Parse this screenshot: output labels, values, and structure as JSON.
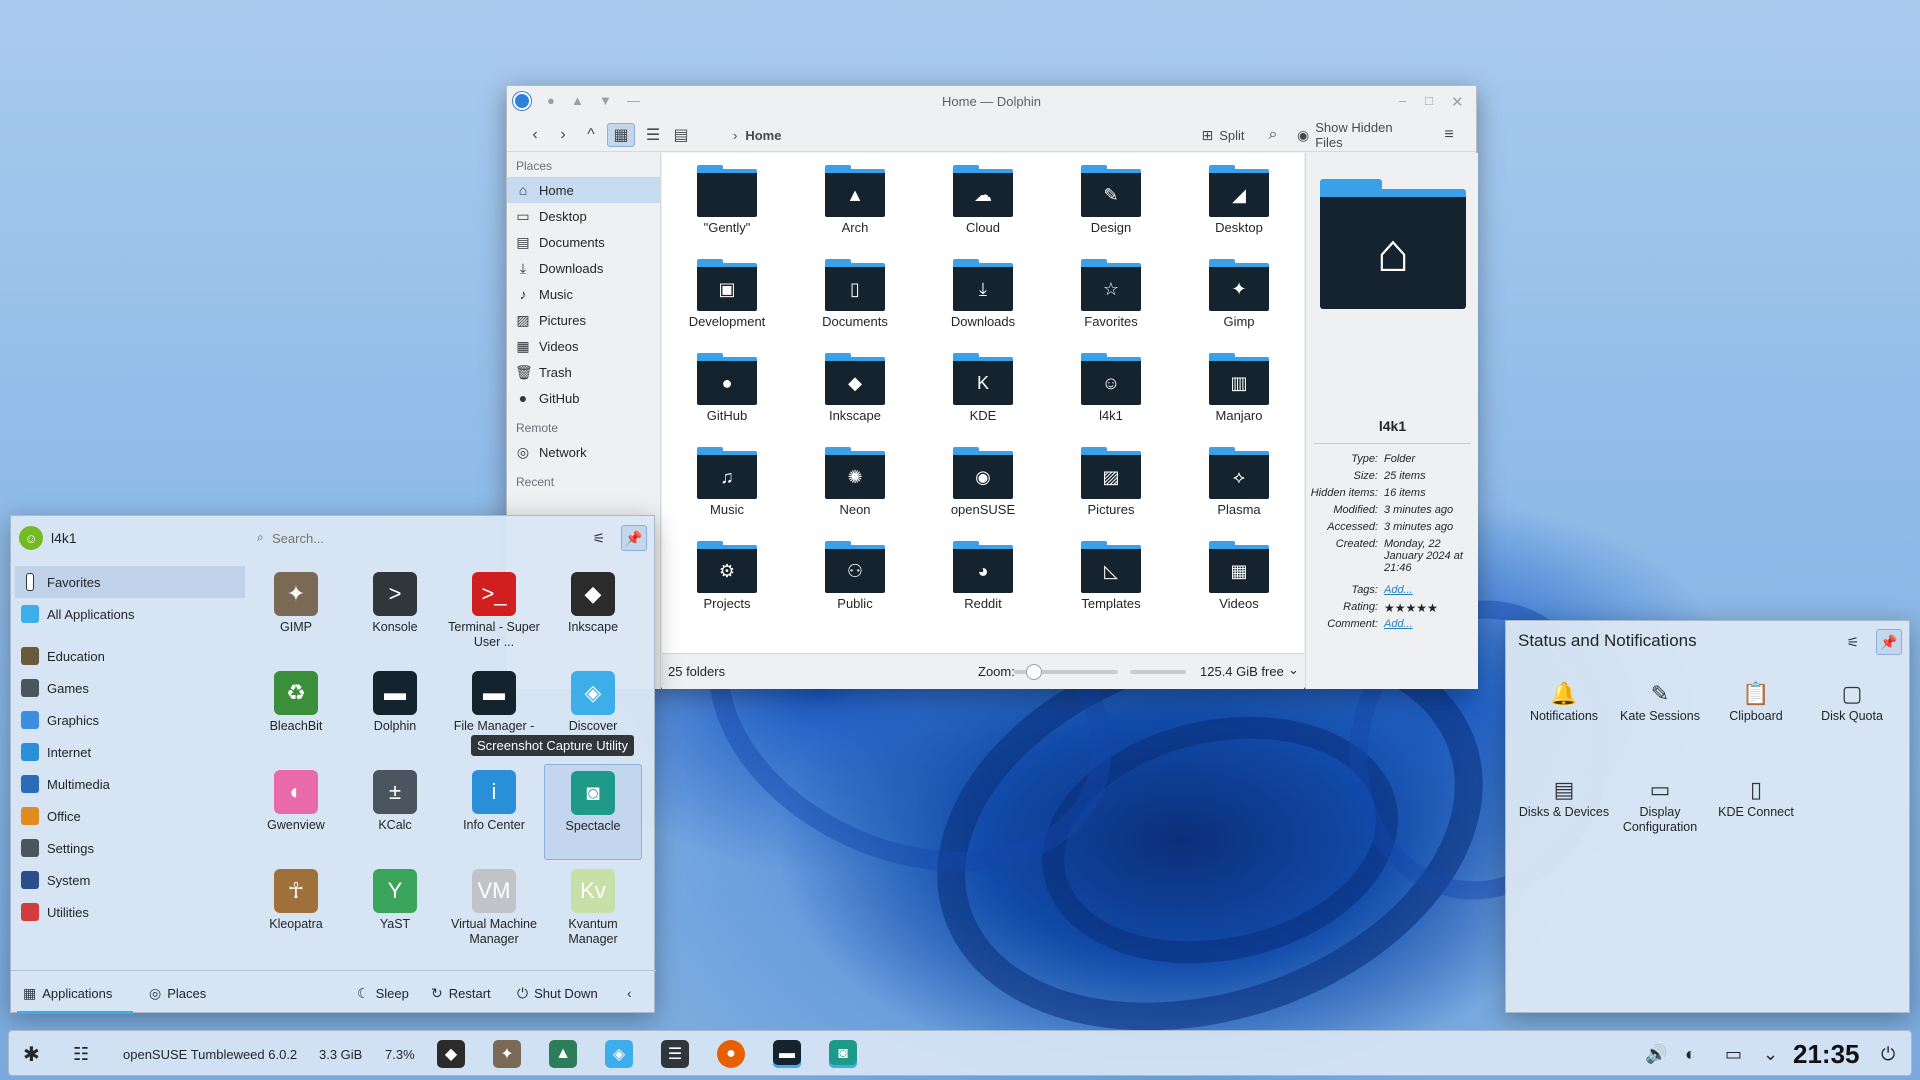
{
  "dolphin": {
    "title": "Home — Dolphin",
    "breadcrumb": "Home",
    "split_label": "Split",
    "hidden_files_label": "Show Hidden Files",
    "places": {
      "section_places": "Places",
      "section_remote": "Remote",
      "section_recent": "Recent",
      "items": [
        {
          "label": "Home",
          "icon": "home-icon",
          "glyph": "⌂"
        },
        {
          "label": "Desktop",
          "icon": "desktop-icon",
          "glyph": "▭"
        },
        {
          "label": "Documents",
          "icon": "documents-icon",
          "glyph": "▤"
        },
        {
          "label": "Downloads",
          "icon": "downloads-icon",
          "glyph": "⤓"
        },
        {
          "label": "Music",
          "icon": "music-icon",
          "glyph": "♪"
        },
        {
          "label": "Pictures",
          "icon": "pictures-icon",
          "glyph": "▨"
        },
        {
          "label": "Videos",
          "icon": "videos-icon",
          "glyph": "▦"
        },
        {
          "label": "Trash",
          "icon": "trash-icon",
          "glyph": "🗑"
        },
        {
          "label": "GitHub",
          "icon": "github-icon",
          "glyph": "●"
        }
      ],
      "remote_items": [
        {
          "label": "Network",
          "icon": "network-icon",
          "glyph": "◎"
        }
      ]
    },
    "folders": [
      {
        "name": "\"Gently\"",
        "glyph": ""
      },
      {
        "name": "Arch",
        "glyph": "▲"
      },
      {
        "name": "Cloud",
        "glyph": "☁"
      },
      {
        "name": "Design",
        "glyph": "✎"
      },
      {
        "name": "Desktop",
        "glyph": "◢"
      },
      {
        "name": "Development",
        "glyph": "▣"
      },
      {
        "name": "Documents",
        "glyph": "▯"
      },
      {
        "name": "Downloads",
        "glyph": "⤓"
      },
      {
        "name": "Favorites",
        "glyph": "☆"
      },
      {
        "name": "Gimp",
        "glyph": "✦"
      },
      {
        "name": "GitHub",
        "glyph": "●"
      },
      {
        "name": "Inkscape",
        "glyph": "◆"
      },
      {
        "name": "KDE",
        "glyph": "K"
      },
      {
        "name": "l4k1",
        "glyph": "☺"
      },
      {
        "name": "Manjaro",
        "glyph": "▥"
      },
      {
        "name": "Music",
        "glyph": "♫"
      },
      {
        "name": "Neon",
        "glyph": "✺"
      },
      {
        "name": "openSUSE",
        "glyph": "◉"
      },
      {
        "name": "Pictures",
        "glyph": "▨"
      },
      {
        "name": "Plasma",
        "glyph": "⟡"
      },
      {
        "name": "Projects",
        "glyph": "⚙"
      },
      {
        "name": "Public",
        "glyph": "⚇"
      },
      {
        "name": "Reddit",
        "glyph": "◕"
      },
      {
        "name": "Templates",
        "glyph": "◺"
      },
      {
        "name": "Videos",
        "glyph": "▦"
      }
    ],
    "status": {
      "count": "25 folders",
      "zoom_label": "Zoom:",
      "zoom_level": 0.15,
      "free_space": "125.4 GiB free"
    },
    "info": {
      "name": "l4k1",
      "rows": [
        {
          "k": "Type:",
          "v": "Folder"
        },
        {
          "k": "Size:",
          "v": "25 items"
        },
        {
          "k": "Hidden items:",
          "v": "16 items"
        },
        {
          "k": "Modified:",
          "v": "3 minutes ago"
        },
        {
          "k": "Accessed:",
          "v": "3 minutes ago"
        },
        {
          "k": "Created:",
          "v": "Monday, 22 January 2024 at 21:46"
        }
      ],
      "tags_label": "Tags:",
      "tags_value": "Add...",
      "rating_label": "Rating:",
      "rating_stars": 5,
      "comment_label": "Comment:",
      "comment_value": "Add..."
    }
  },
  "launcher": {
    "user": "l4k1",
    "search_placeholder": "Search...",
    "categories": [
      {
        "label": "Favorites",
        "icon": "favorites-icon",
        "color": "#ffffff"
      },
      {
        "label": "All Applications",
        "icon": "all-applications-icon",
        "color": "#3daee9"
      },
      {
        "label": "Education",
        "icon": "education-icon",
        "color": "#6b5a3a"
      },
      {
        "label": "Games",
        "icon": "games-icon",
        "color": "#4b5560"
      },
      {
        "label": "Graphics",
        "icon": "graphics-icon",
        "color": "#3d8ee0"
      },
      {
        "label": "Internet",
        "icon": "internet-icon",
        "color": "#2a8fd9"
      },
      {
        "label": "Multimedia",
        "icon": "multimedia-icon",
        "color": "#2b6cb8"
      },
      {
        "label": "Office",
        "icon": "office-icon",
        "color": "#e08a20"
      },
      {
        "label": "Settings",
        "icon": "settings-icon",
        "color": "#4b5560"
      },
      {
        "label": "System",
        "icon": "system-icon",
        "color": "#2b4f8c"
      },
      {
        "label": "Utilities",
        "icon": "utilities-icon",
        "color": "#d13c3c"
      }
    ],
    "apps": [
      {
        "label": "GIMP",
        "icon": "gimp-icon",
        "glyph": "✦",
        "color": "#7a6a55"
      },
      {
        "label": "Konsole",
        "icon": "konsole-icon",
        "glyph": ">",
        "color": "#31363b"
      },
      {
        "label": "Terminal - Super User ...",
        "icon": "terminal-icon",
        "glyph": ">_",
        "color": "#d11e1e"
      },
      {
        "label": "Inkscape",
        "icon": "inkscape-icon",
        "glyph": "◆",
        "color": "#2b2b2b"
      },
      {
        "label": "BleachBit",
        "icon": "bleachbit-icon",
        "glyph": "♻",
        "color": "#3b8f3b"
      },
      {
        "label": "Dolphin",
        "icon": "dolphin-icon",
        "glyph": "▬",
        "color": "#15232e"
      },
      {
        "label": "File Manager - Sup...",
        "icon": "file-manager-icon",
        "glyph": "▬",
        "color": "#15232e"
      },
      {
        "label": "Discover",
        "icon": "discover-icon",
        "glyph": "◈",
        "color": "#3daee9"
      },
      {
        "label": "Gwenview",
        "icon": "gwenview-icon",
        "glyph": "◐",
        "color": "#e86aa8"
      },
      {
        "label": "KCalc",
        "icon": "kcalc-icon",
        "glyph": "±",
        "color": "#4b5560"
      },
      {
        "label": "Info Center",
        "icon": "info-center-icon",
        "glyph": "i",
        "color": "#2a8fd9"
      },
      {
        "label": "Spectacle",
        "icon": "spectacle-icon",
        "glyph": "◙",
        "color": "#1e9a8a"
      },
      {
        "label": "Kleopatra",
        "icon": "kleopatra-icon",
        "glyph": "☥",
        "color": "#a0703a"
      },
      {
        "label": "YaST",
        "icon": "yast-icon",
        "glyph": "Y",
        "color": "#3aa55a"
      },
      {
        "label": "Virtual Machine Manager",
        "icon": "virt-manager-icon",
        "glyph": "VM",
        "color": "#c0c4c8"
      },
      {
        "label": "Kvantum Manager",
        "icon": "kvantum-icon",
        "glyph": "Kv",
        "color": "#c8e0a8"
      }
    ],
    "tooltip": "Screenshot Capture Utility",
    "footer": {
      "applications": "Applications",
      "places": "Places",
      "sleep": "Sleep",
      "restart": "Restart",
      "shutdown": "Shut Down"
    }
  },
  "status_panel": {
    "title": "Status and Notifications",
    "items": [
      {
        "label": "Notifications",
        "icon": "bell-icon",
        "glyph": "🔔"
      },
      {
        "label": "Kate Sessions",
        "icon": "kate-icon",
        "glyph": "✎"
      },
      {
        "label": "Clipboard",
        "icon": "clipboard-icon",
        "glyph": "📋"
      },
      {
        "label": "Disk Quota",
        "icon": "disk-quota-icon",
        "glyph": "▢"
      },
      {
        "label": "Disks & Devices",
        "icon": "disks-icon",
        "glyph": "▤"
      },
      {
        "label": "Display Configuration",
        "icon": "display-icon",
        "glyph": "▭"
      },
      {
        "label": "KDE Connect",
        "icon": "kde-connect-icon",
        "glyph": "▯"
      }
    ]
  },
  "taskbar": {
    "os_label": "openSUSE Tumbleweed 6.0.2",
    "memory": "3.3 GiB",
    "cpu": "7.3%",
    "clock": "21:35"
  }
}
